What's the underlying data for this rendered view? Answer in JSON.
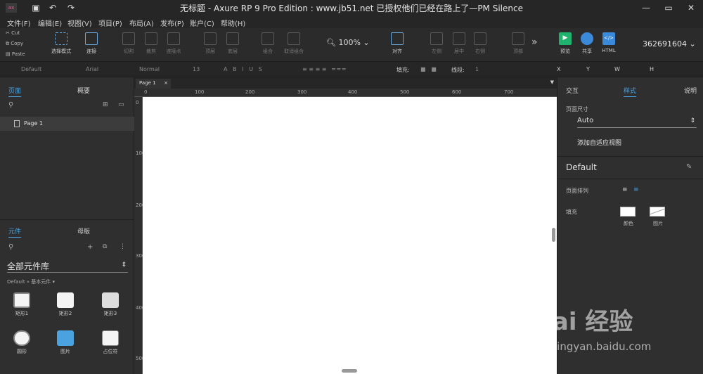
{
  "title": "无标题 - Axure RP 9 Pro Edition : www.jb51.net 已授权他们已经在路上了—PM Silence",
  "menu": [
    "文件(F)",
    "编辑(E)",
    "视图(V)",
    "项目(P)",
    "布局(A)",
    "发布(P)",
    "账户(C)",
    "帮助(H)"
  ],
  "clipboard": [
    "Cut",
    "Copy",
    "Paste"
  ],
  "toolbar": {
    "select_mode": "选择模式",
    "connect": "连接",
    "cut": "切割",
    "crop": "裁剪",
    "connect_point": "连接点",
    "top": "顶层",
    "bottom": "底层",
    "group": "组合",
    "ungroup": "取消组合",
    "zoom": "100%",
    "align": "对齐",
    "left": "左侧",
    "center": "居中",
    "right": "右侧",
    "top2": "顶部",
    "preview": "预览",
    "share": "共享",
    "html": "HTML",
    "account": "362691604"
  },
  "format": {
    "style": "Default",
    "font": "Arial",
    "weight": "Normal",
    "size": "13",
    "fill_label": "填充:",
    "line_label": "线段:",
    "line_value": "1",
    "x": "X",
    "y": "Y",
    "w": "W",
    "h": "H"
  },
  "left": {
    "tab_pages": "页面",
    "tab_outline": "概要",
    "page1": "Page 1",
    "tab_widgets": "元件",
    "tab_masters": "母版",
    "library": "全部元件库",
    "breadcrumb": "Default » 基本元件 ▾",
    "widgets": [
      "矩形1",
      "矩形2",
      "矩形3",
      "圆形",
      "图片",
      "占位符"
    ]
  },
  "canvas": {
    "tab": "Page 1",
    "hticks": [
      "0",
      "100",
      "200",
      "300",
      "400",
      "500",
      "600",
      "700"
    ],
    "vticks": [
      "0",
      "100",
      "200",
      "300",
      "400",
      "500"
    ]
  },
  "right": {
    "tab_interaction": "交互",
    "tab_style": "样式",
    "tab_notes": "说明",
    "page_size_label": "页面尺寸",
    "page_size_value": "Auto",
    "add_view": "添加自适应视图",
    "default": "Default",
    "page_align": "页面排列",
    "fill": "填充",
    "color": "颜色",
    "image": "图片"
  },
  "watermark": {
    "brand": "Bai 经验",
    "url": "jingyan.baidu.com"
  }
}
